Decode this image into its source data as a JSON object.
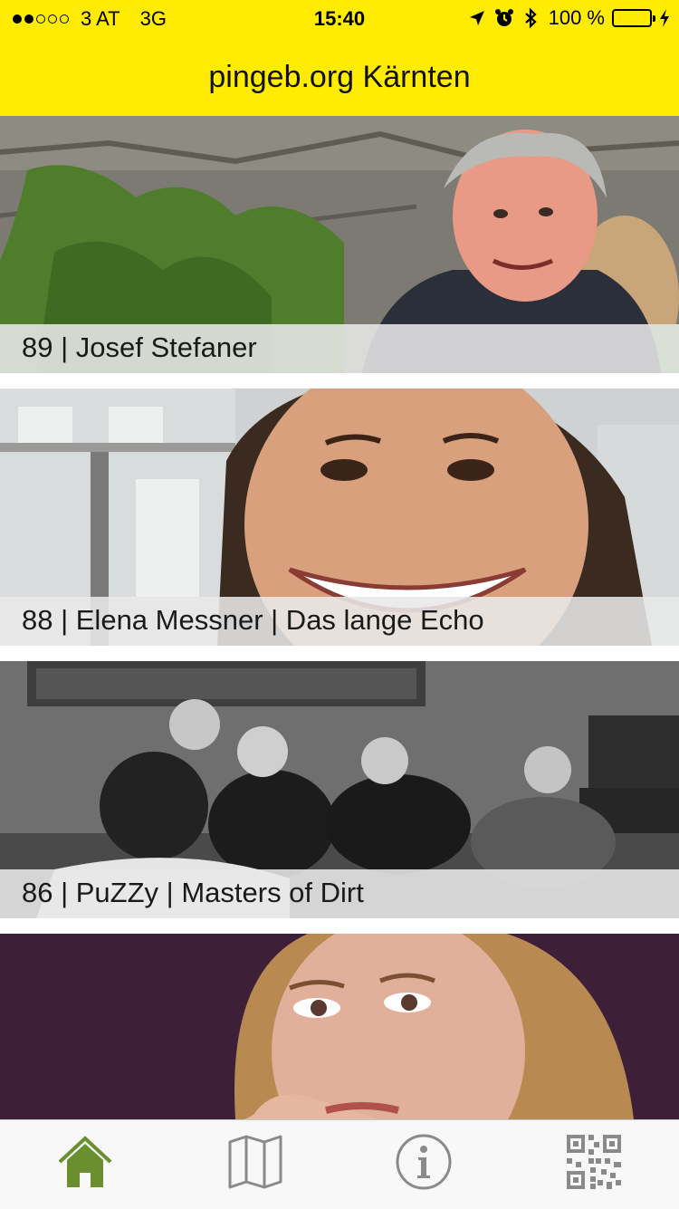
{
  "status_bar": {
    "carrier": "3 AT",
    "network": "3G",
    "time": "15:40",
    "battery_percent": "100 %",
    "signal_filled": 2,
    "signal_total": 5,
    "icons": [
      "location-arrow-icon",
      "alarm-clock-icon",
      "bluetooth-icon",
      "battery-icon",
      "charging-bolt-icon"
    ],
    "battery_color": "#4cd964"
  },
  "nav": {
    "title": "pingeb.org Kärnten",
    "background": "#ffec00"
  },
  "feed": {
    "items": [
      {
        "caption": "89 | Josef Stefaner",
        "image": "portrait-elderly-man"
      },
      {
        "caption": "88 | Elena Messner | Das lange Echo",
        "image": "portrait-smiling-woman"
      },
      {
        "caption": "86 | PuZZy | Masters of Dirt",
        "image": "band-photo-black-white"
      },
      {
        "caption": "",
        "image": "portrait-woman-purple-background"
      }
    ]
  },
  "tabbar": {
    "tabs": [
      {
        "icon": "home-icon",
        "active": true
      },
      {
        "icon": "map-icon",
        "active": false
      },
      {
        "icon": "info-icon",
        "active": false
      },
      {
        "icon": "qr-code-icon",
        "active": false
      }
    ],
    "active_color": "#6a8f2e",
    "inactive_color": "#8a8a8a"
  }
}
